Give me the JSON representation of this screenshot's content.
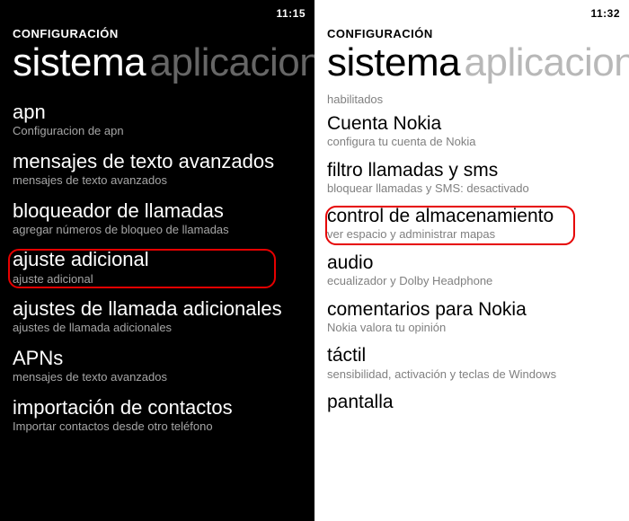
{
  "left": {
    "time": "11:15",
    "header": "CONFIGURACIÓN",
    "pivot_active": "sistema",
    "pivot_inactive": "aplicaciones",
    "items": [
      {
        "title": "apn",
        "sub": "Configuracion de apn"
      },
      {
        "title": "mensajes de texto avanzados",
        "sub": "mensajes de texto avanzados"
      },
      {
        "title": "bloqueador de llamadas",
        "sub": "agregar números de bloqueo de llamadas"
      },
      {
        "title": "ajuste adicional",
        "sub": "ajuste adicional"
      },
      {
        "title": "ajustes de llamada adicionales",
        "sub": "ajustes de llamada adicionales"
      },
      {
        "title": "APNs",
        "sub": "mensajes de texto avanzados"
      },
      {
        "title": "importación de contactos",
        "sub": "Importar contactos desde otro teléfono"
      }
    ]
  },
  "right": {
    "time": "11:32",
    "header": "CONFIGURACIÓN",
    "pivot_active": "sistema",
    "pivot_inactive": "aplicaciones",
    "enabled_tag": "habilitados",
    "items": [
      {
        "title": "Cuenta Nokia",
        "sub": "configura tu cuenta de Nokia"
      },
      {
        "title": "filtro llamadas y sms",
        "sub": "bloquear llamadas y SMS: desactivado"
      },
      {
        "title": "control de almacenamiento",
        "sub": "ver espacio y administrar mapas"
      },
      {
        "title": "audio",
        "sub": "ecualizador y Dolby Headphone"
      },
      {
        "title": "comentarios para Nokia",
        "sub": "Nokia valora tu opinión"
      },
      {
        "title": "táctil",
        "sub": "sensibilidad, activación y teclas de Windows"
      },
      {
        "title": "pantalla",
        "sub": ""
      }
    ]
  },
  "highlight_color": "#e60000"
}
